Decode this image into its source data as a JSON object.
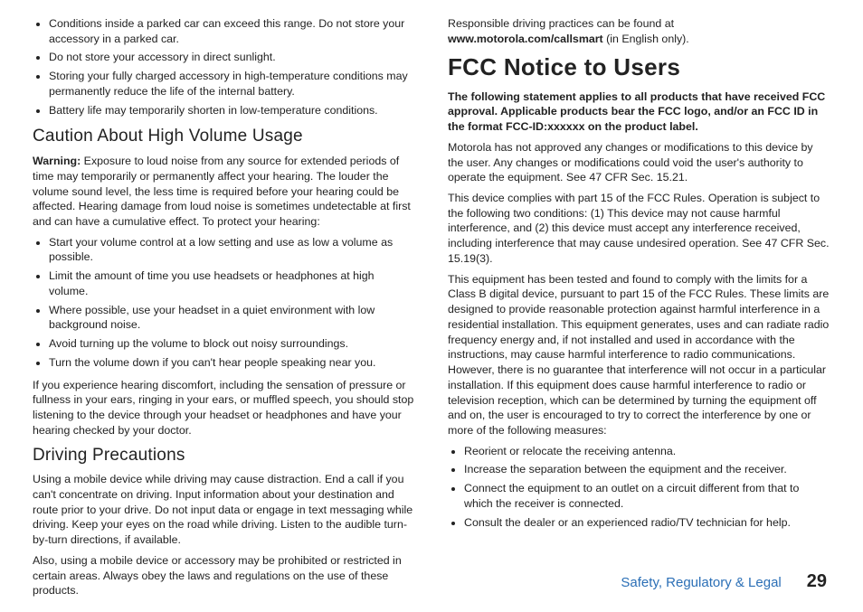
{
  "left": {
    "top_bullets": [
      "Conditions inside a parked car can exceed this range. Do not store your accessory in a parked car.",
      "Do not store your accessory in direct sunlight.",
      "Storing your fully charged accessory in high-temperature conditions may permanently reduce the life of the internal battery.",
      "Battery life may temporarily shorten in low-temperature conditions."
    ],
    "h_volume": "Caution About High Volume Usage",
    "volume_warning_label": "Warning:",
    "volume_warning_text": " Exposure to loud noise from any source for extended periods of time may temporarily or permanently affect your hearing. The louder the volume sound level, the less time is required before your hearing could be affected. Hearing damage from loud noise is sometimes undetectable at first and can have a cumulative effect. To protect your hearing:",
    "volume_bullets": [
      "Start your volume control at a low setting and use as low a volume as possible.",
      "Limit the amount of time you use headsets or headphones at high volume.",
      "Where possible, use your headset in a quiet environment with low background noise.",
      "Avoid turning up the volume to block out noisy surroundings.",
      "Turn the volume down if you can't hear people speaking near you."
    ],
    "volume_after": "If you experience hearing discomfort, including the sensation of pressure or fullness in your ears, ringing in your ears, or muffled speech, you should stop listening to the device through your headset or headphones and have your hearing checked by your doctor.",
    "h_driving": "Driving Precautions",
    "driving_p1": "Using a mobile device while driving may cause distraction. End a call if you can't concentrate on driving. Input information about your destination and route prior to your drive. Do not input data or engage in text messaging while driving. Keep your eyes on the road while driving. Listen to the audible turn-by-turn directions, if available.",
    "driving_p2": "Also, using a mobile device or accessory may be prohibited or restricted in certain areas. Always obey the laws and regulations on the use of these products."
  },
  "right": {
    "driving_link_prefix": "Responsible driving practices can be found at ",
    "driving_link_bold": "www.motorola.com/callsmart",
    "driving_link_suffix": " (in English only).",
    "h_fcc": "FCC Notice to Users",
    "fcc_bold": "The following statement applies to all products that have received FCC approval. Applicable products bear the FCC logo, and/or an FCC ID in the format FCC-ID:xxxxxx on the product label.",
    "fcc_p1": "Motorola has not approved any changes or modifications to this device by the user. Any changes or modifications could void the user's authority to operate the equipment. See 47 CFR Sec. 15.21.",
    "fcc_p2": "This device complies with part 15 of the FCC Rules. Operation is subject to the following two conditions: (1) This device may not cause harmful interference, and (2) this device must accept any interference received, including interference that may cause undesired operation. See 47 CFR Sec. 15.19(3).",
    "fcc_p3": "This equipment has been tested and found to comply with the limits for a Class B digital device, pursuant to part 15 of the FCC Rules. These limits are designed to provide reasonable protection against harmful interference in a residential installation. This equipment generates, uses and can radiate radio frequency energy and, if not installed and used in accordance with the instructions, may cause harmful interference to radio communications. However, there is no guarantee that interference will not occur in a particular installation. If this equipment does cause harmful interference to radio or television reception, which can be determined by turning the equipment off and on, the user is encouraged to try to correct the interference by one or more of the following measures:",
    "fcc_bullets": [
      "Reorient or relocate the receiving antenna.",
      "Increase the separation between the equipment and the receiver.",
      "Connect the equipment to an outlet on a circuit different from that to which the receiver is connected.",
      "Consult the dealer or an experienced radio/TV technician for help."
    ]
  },
  "footer": {
    "section": "Safety, Regulatory & Legal",
    "page": "29"
  }
}
